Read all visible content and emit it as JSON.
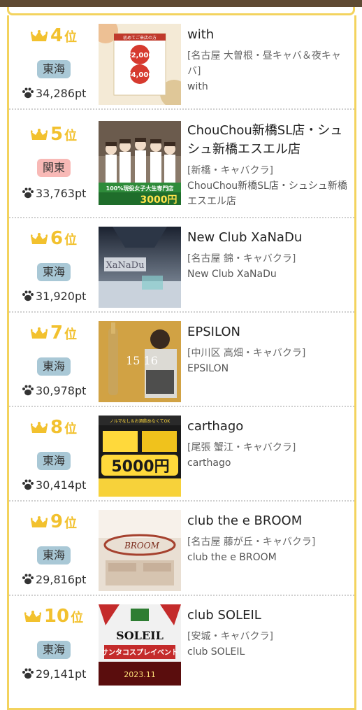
{
  "ranking": {
    "points_unit": "pt",
    "rank_suffix": "位",
    "items": [
      {
        "rank": "4",
        "region": "東海",
        "points": "34,286pt",
        "title": "with",
        "area": "[名古屋 大曽根・昼キャバ＆夜キャバ]",
        "store": "with",
        "thumb": {
          "p1": "¥2,000",
          "p2": "¥4,000",
          "banner": "初めてご来店の方"
        }
      },
      {
        "rank": "5",
        "region": "関東",
        "points": "33,763pt",
        "title": "ChouChou新橋SL店・シュシュ新橋エスエル店",
        "area": "[新橋・キャバクラ]",
        "store": "ChouChou新橋SL店・シュシュ新橋エスエル店",
        "thumb": {
          "line1": "100%現役女子大生専門店",
          "price": "3000円"
        }
      },
      {
        "rank": "6",
        "region": "東海",
        "points": "31,920pt",
        "title": "New Club XaNaDu",
        "area": "[名古屋 錦・キャバクラ]",
        "store": "New Club XaNaDu",
        "thumb": {
          "logo": "XaNaDu"
        }
      },
      {
        "rank": "7",
        "region": "東海",
        "points": "30,978pt",
        "title": "EPSILON",
        "area": "[中川区 高畑・キャバクラ]",
        "store": "EPSILON",
        "thumb": {
          "dates": "15 16"
        }
      },
      {
        "rank": "8",
        "region": "東海",
        "points": "30,414pt",
        "title": "carthago",
        "area": "[尾張 蟹江・キャバクラ]",
        "store": "carthago",
        "thumb": {
          "price": "5000円",
          "top": "ノルマなし＆お酒飲めなくてOK"
        }
      },
      {
        "rank": "9",
        "region": "東海",
        "points": "29,816pt",
        "title": "club the e BROOM",
        "area": "[名古屋 藤が丘・キャバクラ]",
        "store": "club the e BROOM",
        "thumb": {
          "logo": "BROOM"
        }
      },
      {
        "rank": "10",
        "region": "東海",
        "points": "29,141pt",
        "title": "club SOLEIL",
        "area": "[安城・キャバクラ]",
        "store": "club SOLEIL",
        "thumb": {
          "logo": "SOLEIL",
          "event": "サンタコスプレイベント",
          "date": "2023.11"
        }
      }
    ]
  },
  "colors": {
    "accent": "#f2c12e",
    "frame": "#f3d35e",
    "tokai_badge": "#a9c8d6",
    "kanto_badge": "#f8b9b6",
    "header_bar": "#5f4a33"
  },
  "icons": {
    "rank": "crown-icon",
    "points": "paw-icon"
  }
}
